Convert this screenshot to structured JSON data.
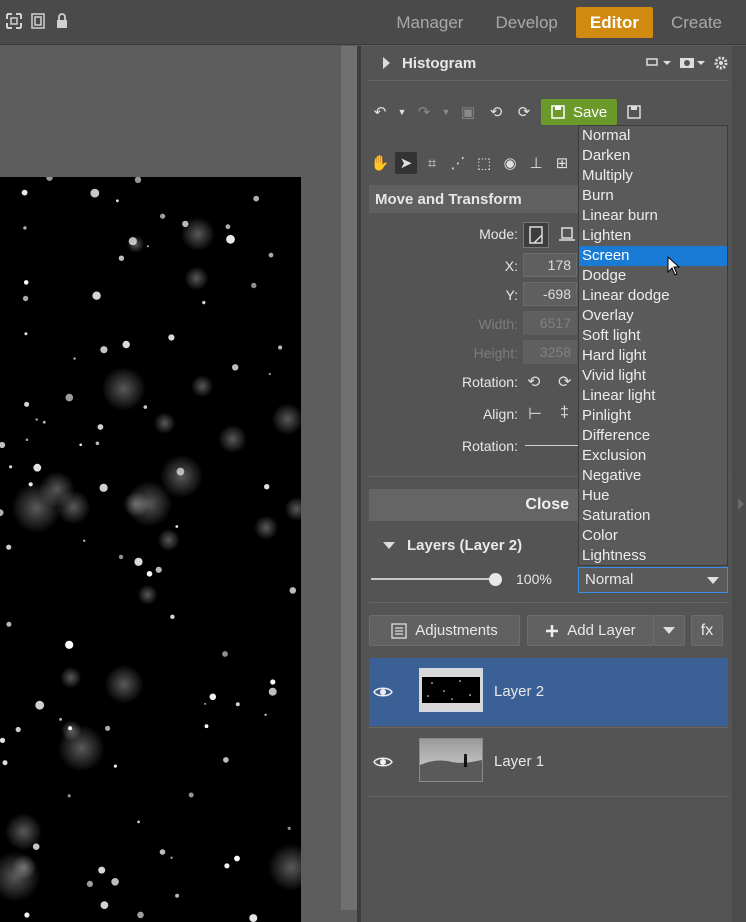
{
  "modes": [
    "Manager",
    "Develop",
    "Editor",
    "Create"
  ],
  "active_mode": "Editor",
  "histogram": {
    "title": "Histogram"
  },
  "toolbar": {
    "save_label": "Save"
  },
  "move_transform": {
    "title": "Move and Transform",
    "mode_label": "Mode:",
    "x_label": "X:",
    "x_value": "178",
    "y_label": "Y:",
    "y_value": "-698",
    "width_label": "Width:",
    "width_value": "6517",
    "height_label": "Height:",
    "height_value": "3258",
    "rotation_label": "Rotation:",
    "align_label": "Align:",
    "rotation2_label": "Rotation:"
  },
  "close_label": "Close",
  "layers": {
    "title": "Layers (Layer 2)",
    "opacity": "100%",
    "opacity_fraction": 1.0,
    "blend_mode": "Normal",
    "adjustments_label": "Adjustments",
    "add_layer_label": "Add Layer",
    "fx_label": "fx",
    "items": [
      {
        "name": "Layer 2",
        "selected": true
      },
      {
        "name": "Layer 1",
        "selected": false
      }
    ]
  },
  "blend_modes": [
    "Normal",
    "Darken",
    "Multiply",
    "Burn",
    "Linear burn",
    "Lighten",
    "Screen",
    "Dodge",
    "Linear dodge",
    "Overlay",
    "Soft light",
    "Hard light",
    "Vivid light",
    "Linear light",
    "Pinlight",
    "Difference",
    "Exclusion",
    "Negative",
    "Hue",
    "Saturation",
    "Color",
    "Lightness"
  ],
  "highlighted_blend_mode": "Screen",
  "colors": {
    "accent": "#d08a10",
    "save": "#6b9a2a",
    "selection": "#3a6096",
    "highlight": "#1a7bd6"
  }
}
